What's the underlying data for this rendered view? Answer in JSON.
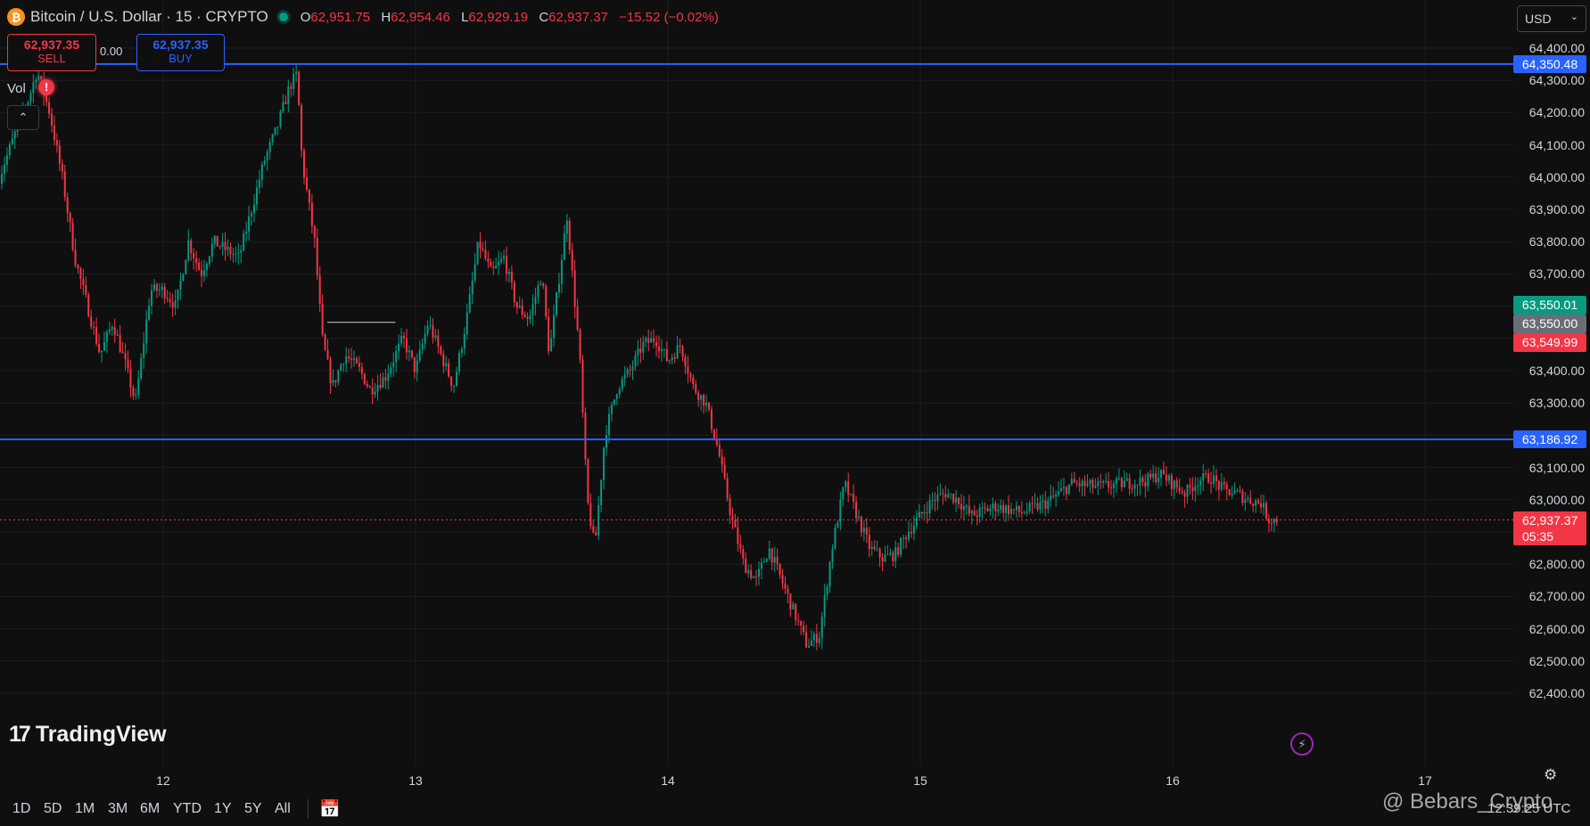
{
  "header": {
    "coin_icon": "₿",
    "symbol": "Bitcoin / U.S. Dollar · 15 · CRYPTO",
    "open_key": "O",
    "open": "62,951.75",
    "high_key": "H",
    "high": "62,954.46",
    "low_key": "L",
    "low": "62,929.19",
    "close_key": "C",
    "close": "62,937.37",
    "change": "−15.52 (−0.02%)"
  },
  "trade": {
    "sell_price": "62,937.35",
    "sell_label": "SELL",
    "spread": "0.00",
    "buy_price": "62,937.35",
    "buy_label": "BUY"
  },
  "indicators": {
    "vol_label": "Vol",
    "warning": "!",
    "collapse_icon": "chevron-up-icon"
  },
  "currency": {
    "value": "USD",
    "icon": "chevron-down-icon"
  },
  "colors": {
    "up": "#089981",
    "down": "#f23645",
    "hline": "#2962ff",
    "bg": "#0f0f0f"
  },
  "chart_data": {
    "type": "candlestick",
    "timeframe": "15",
    "y_ticks": [
      "64,400.00",
      "64,300.00",
      "64,200.00",
      "64,100.00",
      "64,000.00",
      "63,900.00",
      "63,800.00",
      "63,700.00",
      "63,600.00",
      "63,500.00",
      "63,400.00",
      "63,300.00",
      "63,200.00",
      "63,100.00",
      "63,000.00",
      "62,900.00",
      "62,800.00",
      "62,700.00",
      "62,600.00",
      "62,500.00",
      "62,400.00"
    ],
    "ylim": [
      62380,
      64450
    ],
    "x_ticks": [
      "12",
      "13",
      "14",
      "15",
      "16",
      "17"
    ],
    "xlim": [
      11.35,
      17.5
    ],
    "price_path": [
      [
        11.35,
        64000
      ],
      [
        11.42,
        64150
      ],
      [
        11.47,
        64250
      ],
      [
        11.5,
        64330
      ],
      [
        11.55,
        64200
      ],
      [
        11.6,
        64000
      ],
      [
        11.65,
        63750
      ],
      [
        11.7,
        63600
      ],
      [
        11.75,
        63450
      ],
      [
        11.8,
        63550
      ],
      [
        11.85,
        63420
      ],
      [
        11.89,
        63300
      ],
      [
        11.95,
        63650
      ],
      [
        12.0,
        63650
      ],
      [
        12.05,
        63600
      ],
      [
        12.1,
        63800
      ],
      [
        12.15,
        63700
      ],
      [
        12.2,
        63800
      ],
      [
        12.3,
        63750
      ],
      [
        12.35,
        63900
      ],
      [
        12.4,
        64050
      ],
      [
        12.45,
        64150
      ],
      [
        12.5,
        64280
      ],
      [
        12.53,
        64320
      ],
      [
        12.55,
        64050
      ],
      [
        12.6,
        63800
      ],
      [
        12.63,
        63500
      ],
      [
        12.67,
        63350
      ],
      [
        12.72,
        63450
      ],
      [
        12.78,
        63400
      ],
      [
        12.82,
        63340
      ],
      [
        12.88,
        63380
      ],
      [
        12.95,
        63500
      ],
      [
        13.0,
        63400
      ],
      [
        13.05,
        63550
      ],
      [
        13.1,
        63450
      ],
      [
        13.15,
        63350
      ],
      [
        13.2,
        63550
      ],
      [
        13.25,
        63800
      ],
      [
        13.3,
        63700
      ],
      [
        13.35,
        63750
      ],
      [
        13.4,
        63600
      ],
      [
        13.45,
        63560
      ],
      [
        13.5,
        63700
      ],
      [
        13.53,
        63450
      ],
      [
        13.6,
        63880
      ],
      [
        13.65,
        63450
      ],
      [
        13.68,
        63000
      ],
      [
        13.71,
        62850
      ],
      [
        13.75,
        63200
      ],
      [
        13.8,
        63350
      ],
      [
        13.85,
        63400
      ],
      [
        13.9,
        63480
      ],
      [
        13.95,
        63500
      ],
      [
        14.0,
        63430
      ],
      [
        14.05,
        63480
      ],
      [
        14.1,
        63350
      ],
      [
        14.15,
        63300
      ],
      [
        14.2,
        63150
      ],
      [
        14.25,
        62950
      ],
      [
        14.3,
        62800
      ],
      [
        14.35,
        62750
      ],
      [
        14.4,
        62850
      ],
      [
        14.45,
        62750
      ],
      [
        14.5,
        62650
      ],
      [
        14.55,
        62550
      ],
      [
        14.6,
        62580
      ],
      [
        14.65,
        62850
      ],
      [
        14.7,
        63050
      ],
      [
        14.75,
        62950
      ],
      [
        14.8,
        62850
      ],
      [
        14.85,
        62820
      ],
      [
        14.9,
        62830
      ],
      [
        14.95,
        62900
      ],
      [
        15.0,
        62950
      ],
      [
        15.05,
        63000
      ],
      [
        15.1,
        63020
      ],
      [
        15.15,
        63000
      ],
      [
        15.2,
        62950
      ],
      [
        15.3,
        62980
      ],
      [
        15.4,
        62960
      ],
      [
        15.5,
        62990
      ],
      [
        15.6,
        63050
      ],
      [
        15.7,
        63040
      ],
      [
        15.8,
        63050
      ],
      [
        15.9,
        63060
      ],
      [
        15.95,
        63080
      ],
      [
        16.0,
        63050
      ],
      [
        16.05,
        63020
      ],
      [
        16.1,
        63060
      ],
      [
        16.15,
        63070
      ],
      [
        16.2,
        63030
      ],
      [
        16.25,
        63020
      ],
      [
        16.3,
        63000
      ],
      [
        16.35,
        62990
      ],
      [
        16.38,
        62940
      ],
      [
        16.42,
        62937.37
      ]
    ],
    "horizontal_lines": [
      {
        "label": "64,350.48",
        "price": 64350.48
      },
      {
        "label": "63,186.92",
        "price": 63186.92
      }
    ],
    "segment": {
      "from_x": 12.65,
      "to_x": 12.92,
      "price": 63550
    },
    "price_tags": [
      {
        "label": "63,550.01",
        "price": 63558,
        "color": "#089981"
      },
      {
        "label": "63,550.00",
        "price": 63550,
        "color": "#6a6d78"
      },
      {
        "label": "63,549.99",
        "price": 63540,
        "color": "#f23645"
      }
    ],
    "last_price": {
      "label": "62,937.37",
      "countdown": "05:35",
      "price": 62937.37
    }
  },
  "footer": {
    "ranges": [
      "1D",
      "5D",
      "1M",
      "3M",
      "6M",
      "YTD",
      "1Y",
      "5Y",
      "All"
    ],
    "goto_icon": "calendar-goto-icon",
    "time": "12:39:25 UTC",
    "settings_icon": "gear-icon",
    "logo_mark": "17",
    "logo_text": "TradingView",
    "watermark": "@ Bebars_Crypto",
    "bolt_icon": "lightning-icon"
  }
}
